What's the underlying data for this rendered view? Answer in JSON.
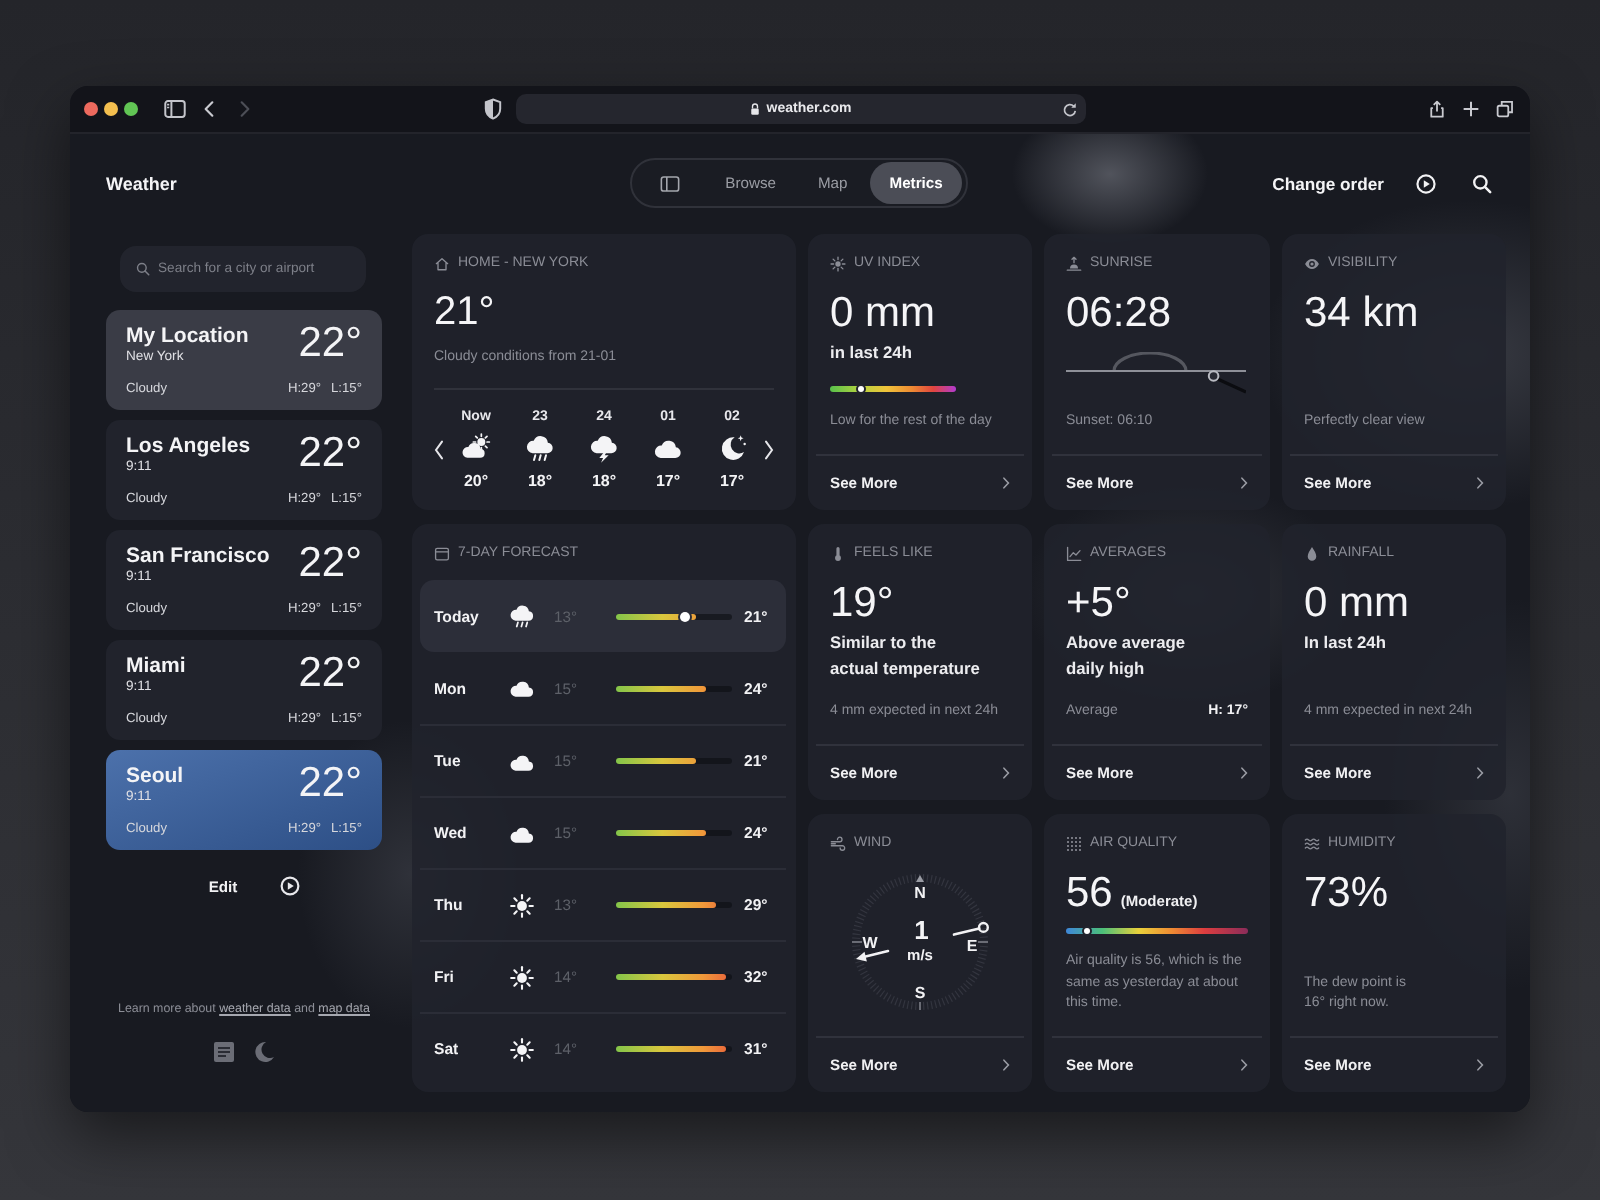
{
  "browser": {
    "address": "weather.com",
    "nav": [
      {
        "kind": "back",
        "disabled": false
      },
      {
        "kind": "forward",
        "disabled": true
      }
    ]
  },
  "app_bar": {
    "title": "Weather",
    "tabs": [
      {
        "kind": "sidebar",
        "selected": false
      },
      {
        "kind": "text",
        "label": "Browse",
        "selected": false
      },
      {
        "kind": "text",
        "label": "Map",
        "selected": false
      },
      {
        "kind": "text",
        "label": "Metrics",
        "selected": true
      }
    ],
    "action": "Change order"
  },
  "sidebar": {
    "search": {
      "placeholder": "Search for a city or airport"
    },
    "locations": [
      {
        "kind": "current",
        "name": "My Location",
        "detail": "New York",
        "temperature": "22°",
        "condition": "Cloudy",
        "high": "H:29°",
        "low": "L:15°",
        "selected": false
      },
      {
        "kind": "city",
        "name": "Los Angeles",
        "detail": "9:11",
        "temperature": "22°",
        "condition": "Cloudy",
        "high": "H:29°",
        "low": "L:15°",
        "selected": false
      },
      {
        "kind": "city",
        "name": "San Francisco",
        "detail": "9:11",
        "temperature": "22°",
        "condition": "Cloudy",
        "high": "H:29°",
        "low": "L:15°",
        "selected": false
      },
      {
        "kind": "city",
        "name": "Miami",
        "detail": "9:11",
        "temperature": "22°",
        "condition": "Cloudy",
        "high": "H:29°",
        "low": "L:15°",
        "selected": false
      },
      {
        "kind": "city",
        "name": "Seoul",
        "detail": "9:11",
        "temperature": "22°",
        "condition": "Cloudy",
        "high": "H:29°",
        "low": "L:15°",
        "selected": true
      }
    ],
    "edit": "Edit",
    "footer": [
      {
        "kind": "text",
        "text": "Learn more about"
      },
      {
        "kind": "link",
        "text": "weather data"
      },
      {
        "kind": "text",
        "text": "and"
      },
      {
        "kind": "link",
        "text": "map data"
      }
    ]
  },
  "current": {
    "header": "HOME - NEW YORK",
    "temperature": "21°",
    "summary": "Cloudy conditions from 21-01",
    "hours": [
      {
        "time": "Now",
        "kind": "partly-cloudy",
        "temperature": "20°"
      },
      {
        "time": "23",
        "kind": "rain",
        "temperature": "18°"
      },
      {
        "time": "24",
        "kind": "thunder",
        "temperature": "18°"
      },
      {
        "time": "01",
        "kind": "cloudy",
        "temperature": "17°"
      },
      {
        "time": "02",
        "kind": "clear-night",
        "temperature": "17°"
      }
    ]
  },
  "forecast": {
    "title": "7-DAY FORECAST",
    "days": [
      {
        "day": "Today",
        "kind": "rain",
        "low": "13°",
        "high": "21°",
        "selected": true,
        "level": 0.69,
        "now": {
          "level": 0.59
        }
      },
      {
        "day": "Mon",
        "kind": "cloudy",
        "low": "15°",
        "high": "24°",
        "selected": false,
        "level": 0.78
      },
      {
        "day": "Tue",
        "kind": "cloudy",
        "low": "15°",
        "high": "21°",
        "selected": false,
        "level": 0.69
      },
      {
        "day": "Wed",
        "kind": "cloudy",
        "low": "15°",
        "high": "24°",
        "selected": false,
        "level": 0.78
      },
      {
        "day": "Thu",
        "kind": "sunny",
        "low": "13°",
        "high": "29°",
        "selected": false,
        "level": 0.86
      },
      {
        "day": "Fri",
        "kind": "sunny",
        "low": "14°",
        "high": "32°",
        "selected": false,
        "level": 0.95
      },
      {
        "day": "Sat",
        "kind": "sunny",
        "low": "14°",
        "high": "31°",
        "selected": false,
        "level": 0.95
      }
    ]
  },
  "metrics": [
    {
      "kind": "uv",
      "title": "UV INDEX",
      "value": "0 mm",
      "subtitle": "in last 24h",
      "scale": {
        "level": 0.25
      },
      "note": "Low for the rest of the day",
      "link": "See More"
    },
    {
      "kind": "sunrise",
      "title": "SUNRISE",
      "value": "06:28",
      "sun": {
        "level": 0.82
      },
      "note": "Sunset: 06:10",
      "link": "See More"
    },
    {
      "kind": "visibility",
      "title": "VISIBILITY",
      "value": "34 km",
      "note": "Perfectly clear view",
      "link": "See More"
    },
    {
      "kind": "feels-like",
      "title": "FEELS LIKE",
      "value": "19°",
      "subtitle": "Similar to the actual temperature",
      "note": "4 mm expected in next 24h",
      "link": "See More"
    },
    {
      "kind": "averages",
      "title": "AVERAGES",
      "value": "+5°",
      "subtitle": "Above average daily high",
      "note": "Average",
      "note_value": "H: 17°",
      "link": "See More"
    },
    {
      "kind": "rainfall",
      "title": "RAINFALL",
      "value": "0 mm",
      "subtitle": "In last 24h",
      "note": "4 mm expected in next 24h",
      "link": "See More"
    },
    {
      "kind": "wind",
      "title": "WIND",
      "compass": {
        "north": "N",
        "east": "E",
        "south": "S",
        "west": "W"
      },
      "speed": "1",
      "unit": "m/s",
      "link": "See More"
    },
    {
      "kind": "air-quality",
      "title": "AIR QUALITY",
      "value": "56",
      "qualifier": "(Moderate)",
      "scale": {
        "level": 0.11
      },
      "note": "Air quality is 56, which is the same as yesterday at about this time.",
      "link": "See More"
    },
    {
      "kind": "humidity",
      "title": "HUMIDITY",
      "value": "73%",
      "note": "The dew point is 16° right now.",
      "link": "See More"
    }
  ]
}
